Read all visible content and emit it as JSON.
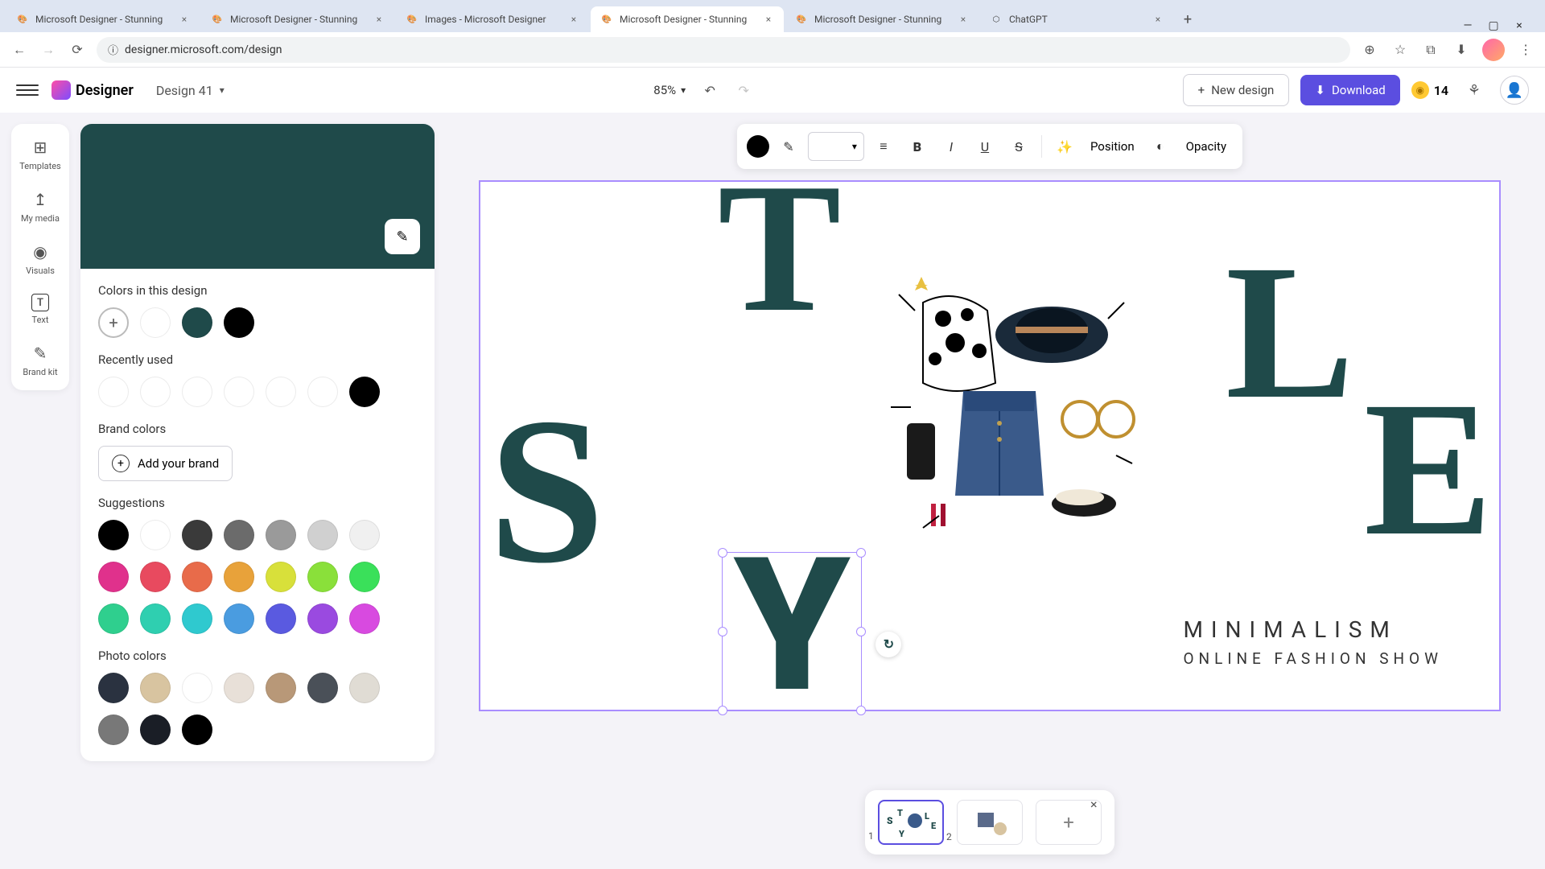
{
  "browser": {
    "tabs": [
      {
        "title": "Microsoft Designer - Stunning",
        "active": false
      },
      {
        "title": "Microsoft Designer - Stunning",
        "active": false
      },
      {
        "title": "Images - Microsoft Designer",
        "active": false
      },
      {
        "title": "Microsoft Designer - Stunning",
        "active": true
      },
      {
        "title": "Microsoft Designer - Stunning",
        "active": false
      },
      {
        "title": "ChatGPT",
        "active": false
      }
    ],
    "url": "designer.microsoft.com/design"
  },
  "app": {
    "logo_text": "Designer",
    "design_name": "Design 41",
    "zoom": "85%",
    "new_design_label": "New design",
    "download_label": "Download",
    "coin_count": "14"
  },
  "left_rail": {
    "items": [
      {
        "label": "Templates",
        "icon": "⊞"
      },
      {
        "label": "My media",
        "icon": "↥"
      },
      {
        "label": "Visuals",
        "icon": "⟲"
      },
      {
        "label": "Text",
        "icon": "T"
      },
      {
        "label": "Brand kit",
        "icon": "✎"
      }
    ]
  },
  "color_panel": {
    "preview_color": "#1f4a4a",
    "sections": {
      "design_colors": {
        "label": "Colors in this design",
        "colors": [
          "#ffffff",
          "#1f4a4a",
          "#000000"
        ]
      },
      "recently_used": {
        "label": "Recently used",
        "colors": [
          "#ffffff",
          "#ffffff",
          "#ffffff",
          "#ffffff",
          "#ffffff",
          "#ffffff",
          "#000000"
        ]
      },
      "brand_colors": {
        "label": "Brand colors",
        "button_label": "Add your brand"
      },
      "suggestions": {
        "label": "Suggestions",
        "colors": [
          "#000000",
          "#ffffff",
          "#3a3a3a",
          "#6b6b6b",
          "#9a9a9a",
          "#d0d0d0",
          "#f0f0f0",
          "#e0318c",
          "#e84a5f",
          "#e86b4a",
          "#e8a23a",
          "#d8e03a",
          "#8ae03a",
          "#3ae05a",
          "#2fcf8e",
          "#2fcfb0",
          "#2fc9cf",
          "#4a9ce0",
          "#5a5ae0",
          "#9a4ae0",
          "#d84ae0"
        ]
      },
      "photo_colors": {
        "label": "Photo colors",
        "colors": [
          "#2a3240",
          "#d8c4a0",
          "#ffffff",
          "#e8e0d8",
          "#b89878",
          "#4a5058",
          "#e0dcd4",
          "#787878",
          "#1a1e26",
          "#000000"
        ]
      }
    }
  },
  "text_toolbar": {
    "color": "#000000",
    "position_label": "Position",
    "opacity_label": "Opacity"
  },
  "canvas": {
    "letters": {
      "s": "S",
      "t": "T",
      "y": "Y",
      "l": "L",
      "e": "E"
    },
    "minimalism": "MINIMALISM",
    "subtitle": "ONLINE FASHION SHOW"
  },
  "thumbnails": {
    "pages": [
      {
        "num": "1",
        "active": true
      },
      {
        "num": "2",
        "active": false
      }
    ]
  }
}
